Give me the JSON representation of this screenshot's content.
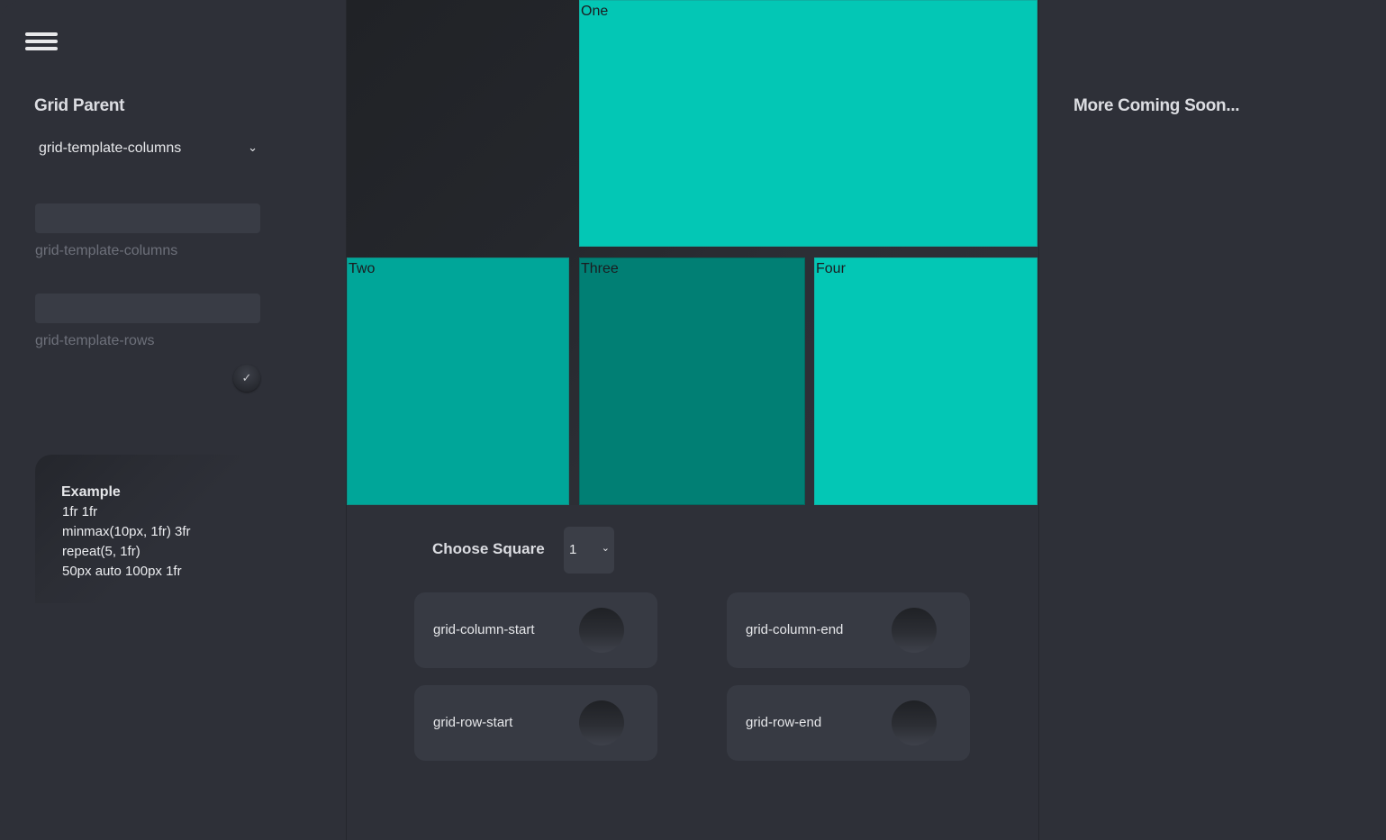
{
  "colors": {
    "bg": "#2e3038",
    "teal_bright": "#03c7b5",
    "teal_mid": "#00a699",
    "teal_dark": "#017f74"
  },
  "left_panel": {
    "title": "Grid Parent",
    "property_select": {
      "value": "grid-template-columns"
    },
    "inputs": [
      {
        "label": "grid-template-columns",
        "value": ""
      },
      {
        "label": "grid-template-rows",
        "value": ""
      }
    ],
    "apply_icon": "✓",
    "example": {
      "title": "Example",
      "lines": [
        "1fr 1fr",
        "minmax(10px, 1fr) 3fr",
        "repeat(5, 1fr)",
        "50px auto 100px 1fr"
      ]
    }
  },
  "grid": {
    "squares": [
      {
        "label": "One"
      },
      {
        "label": "Two"
      },
      {
        "label": "Three"
      },
      {
        "label": "Four"
      }
    ]
  },
  "controls": {
    "choose_label": "Choose Square",
    "square_select": {
      "value": "1"
    },
    "properties": [
      {
        "label": "grid-column-start"
      },
      {
        "label": "grid-column-end"
      },
      {
        "label": "grid-row-start"
      },
      {
        "label": "grid-row-end"
      }
    ]
  },
  "right_panel": {
    "title": "More Coming Soon..."
  }
}
